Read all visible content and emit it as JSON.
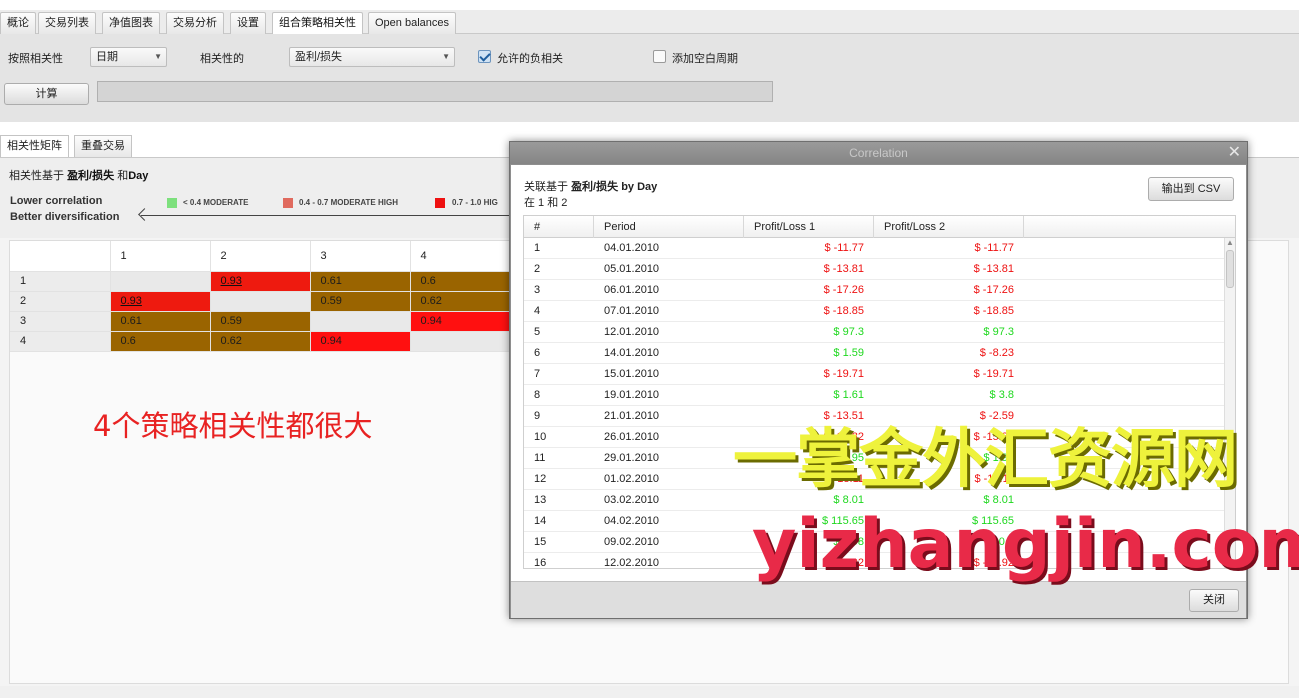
{
  "tabs": [
    {
      "label": "概论",
      "active": false
    },
    {
      "label": "交易列表",
      "active": false
    },
    {
      "label": "净值图表",
      "active": false
    },
    {
      "label": "交易分析",
      "active": false
    },
    {
      "label": "设置",
      "active": false
    },
    {
      "label": "组合策略相关性",
      "active": true
    },
    {
      "label": "Open balances",
      "active": false
    }
  ],
  "options": {
    "by_label": "按照相关性",
    "by_value": "日期",
    "corr_label": "相关性的",
    "corr_value": "盈利/损失",
    "negative_label": "允许的负相关",
    "negative_checked": true,
    "empty_label": "添加空白周期",
    "empty_checked": false,
    "compute_label": "计算"
  },
  "subtabs": [
    {
      "label": "相关性矩阵",
      "active": true
    },
    {
      "label": "重叠交易",
      "active": false
    }
  ],
  "basis": {
    "prefix": "相关性基于",
    "metric": "盈利/损失",
    "and": "和",
    "period": "Day"
  },
  "legend": {
    "low_line1": "Lower correlation",
    "low_line2": "Better diversification",
    "items": [
      {
        "label": "< 0.4 MODERATE",
        "color": "#7de07d"
      },
      {
        "label": "0.4 - 0.7 MODERATE HIGH",
        "color": "#e06a5e"
      },
      {
        "label": "0.7 - 1.0 HIG",
        "color": "#ee1111"
      }
    ]
  },
  "matrix": {
    "headers": [
      "",
      "1",
      "2",
      "3",
      "4"
    ],
    "rows": [
      {
        "label": "1",
        "cells": [
          "",
          "0.93",
          "0.61",
          "0.6"
        ],
        "styles": [
          "empty",
          "sel",
          "brown",
          "brown"
        ]
      },
      {
        "label": "2",
        "cells": [
          "0.93",
          "",
          "0.59",
          "0.62"
        ],
        "styles": [
          "sel",
          "empty",
          "brown",
          "brown"
        ]
      },
      {
        "label": "3",
        "cells": [
          "0.61",
          "0.59",
          "",
          "0.94"
        ],
        "styles": [
          "brown",
          "brown",
          "empty",
          "red"
        ]
      },
      {
        "label": "4",
        "cells": [
          "0.6",
          "0.62",
          "0.94",
          ""
        ],
        "styles": [
          "brown",
          "brown",
          "red",
          "empty"
        ]
      }
    ]
  },
  "annotation": "4个策略相关性都很大",
  "dialog": {
    "title": "Correlation",
    "close_glyph": "✕",
    "info_prefix": "关联基于",
    "info_metric": "盈利/损失",
    "info_by": "by Day",
    "info_line2": "在 1 和 2",
    "export_label": "输出到 CSV",
    "columns": [
      "#",
      "Period",
      "Profit/Loss 1",
      "Profit/Loss 2"
    ],
    "rows": [
      {
        "n": "1",
        "period": "04.01.2010",
        "p1": "$ -11.77",
        "p2": "$ -11.77",
        "p1pos": false,
        "p2pos": false
      },
      {
        "n": "2",
        "period": "05.01.2010",
        "p1": "$ -13.81",
        "p2": "$ -13.81",
        "p1pos": false,
        "p2pos": false
      },
      {
        "n": "3",
        "period": "06.01.2010",
        "p1": "$ -17.26",
        "p2": "$ -17.26",
        "p1pos": false,
        "p2pos": false
      },
      {
        "n": "4",
        "period": "07.01.2010",
        "p1": "$ -18.85",
        "p2": "$ -18.85",
        "p1pos": false,
        "p2pos": false
      },
      {
        "n": "5",
        "period": "12.01.2010",
        "p1": "$ 97.3",
        "p2": "$ 97.3",
        "p1pos": true,
        "p2pos": true
      },
      {
        "n": "6",
        "period": "14.01.2010",
        "p1": "$ 1.59",
        "p2": "$ -8.23",
        "p1pos": true,
        "p2pos": false
      },
      {
        "n": "7",
        "period": "15.01.2010",
        "p1": "$ -19.71",
        "p2": "$ -19.71",
        "p1pos": false,
        "p2pos": false
      },
      {
        "n": "8",
        "period": "19.01.2010",
        "p1": "$ 1.61",
        "p2": "$ 3.8",
        "p1pos": true,
        "p2pos": true
      },
      {
        "n": "9",
        "period": "21.01.2010",
        "p1": "$ -13.51",
        "p2": "$ -2.59",
        "p1pos": false,
        "p2pos": false
      },
      {
        "n": "10",
        "period": "26.01.2010",
        "p1": "$ -15.82",
        "p2": "$ -15.82",
        "p1pos": false,
        "p2pos": false
      },
      {
        "n": "11",
        "period": "29.01.2010",
        "p1": "$ 1.95",
        "p2": "$ 1.95",
        "p1pos": true,
        "p2pos": true
      },
      {
        "n": "12",
        "period": "01.02.2010",
        "p1": "$ -18.11",
        "p2": "$ -18.11",
        "p1pos": false,
        "p2pos": false
      },
      {
        "n": "13",
        "period": "03.02.2010",
        "p1": "$ 8.01",
        "p2": "$ 8.01",
        "p1pos": true,
        "p2pos": true
      },
      {
        "n": "14",
        "period": "04.02.2010",
        "p1": "$ 115.65",
        "p2": "$ 115.65",
        "p1pos": true,
        "p2pos": true
      },
      {
        "n": "15",
        "period": "09.02.2010",
        "p1": "$ 1.98",
        "p2": "$ 0.3",
        "p1pos": true,
        "p2pos": true
      },
      {
        "n": "16",
        "period": "12.02.2010",
        "p1": "$ -12.92",
        "p2": "$ -12.92",
        "p1pos": false,
        "p2pos": false
      }
    ],
    "close_label": "关闭"
  },
  "watermark": {
    "line1": "一掌金外汇资源网",
    "line2": "yizhangjin.com"
  }
}
